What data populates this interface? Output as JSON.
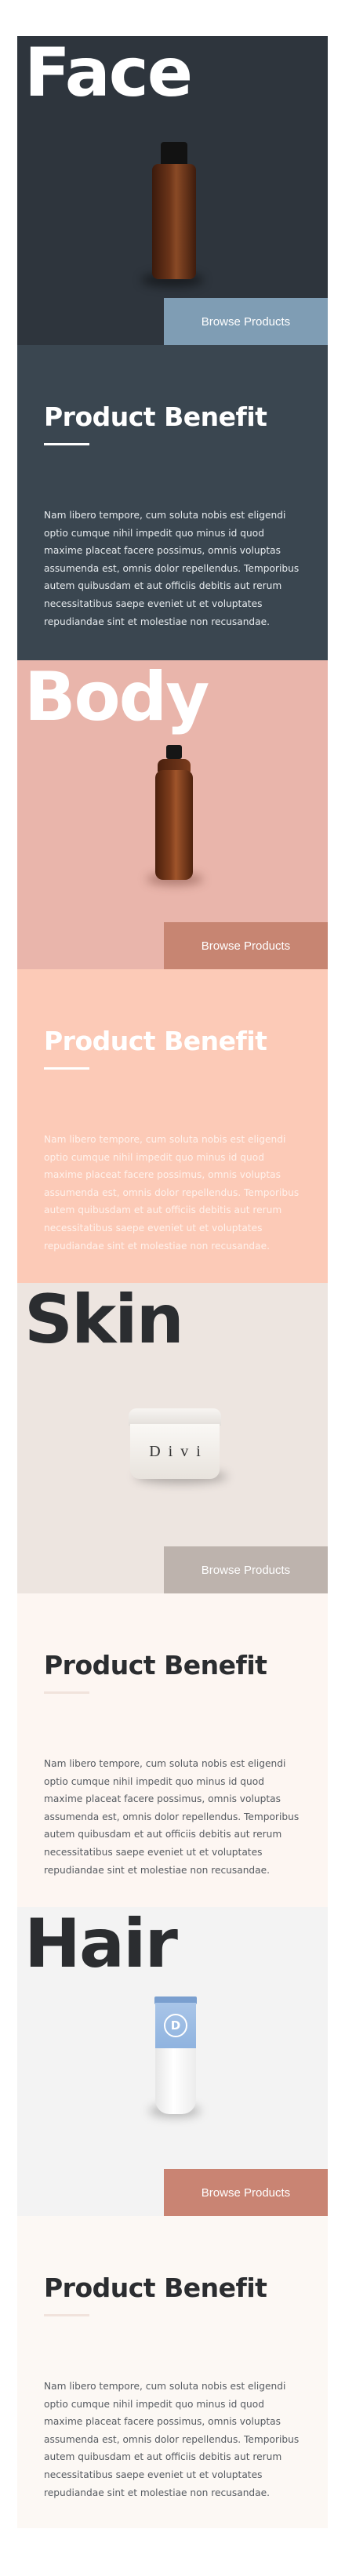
{
  "sections": [
    {
      "title": "Face",
      "browse_label": "Browse Products",
      "benefit_title": "Product Benefit",
      "benefit_text": "Nam libero tempore, cum soluta nobis est eligendi optio cumque nihil impedit quo minus id quod maxime placeat facere possimus, omnis voluptas assumenda est, omnis dolor repellendus. Temporibus autem quibusdam et aut officiis debitis aut rerum necessitatibus saepe eveniet ut et voluptates repudiandae sint et molestiae non recusandae."
    },
    {
      "title": "Body",
      "browse_label": "Browse Products",
      "benefit_title": "Product Benefit",
      "benefit_text": "Nam libero tempore, cum soluta nobis est eligendi optio cumque nihil impedit quo minus id quod maxime placeat facere possimus, omnis voluptas assumenda est, omnis dolor repellendus. Temporibus autem quibusdam et aut officiis debitis aut rerum necessitatibus saepe eveniet ut et voluptates repudiandae sint et molestiae non recusandae."
    },
    {
      "title": "Skin",
      "product_label": "Divi",
      "browse_label": "Browse Products",
      "benefit_title": "Product Benefit",
      "benefit_text": "Nam libero tempore, cum soluta nobis est eligendi optio cumque nihil impedit quo minus id quod maxime placeat facere possimus, omnis voluptas assumenda est, omnis dolor repellendus. Temporibus autem quibusdam et aut officiis debitis aut rerum necessitatibus saepe eveniet ut et voluptates repudiandae sint et molestiae non recusandae."
    },
    {
      "title": "Hair",
      "product_label": "D",
      "browse_label": "Browse Products",
      "benefit_title": "Product Benefit",
      "benefit_text": "Nam libero tempore, cum soluta nobis est eligendi optio cumque nihil impedit quo minus id quod maxime placeat facere possimus, omnis voluptas assumenda est, omnis dolor repellendus. Temporibus autem quibusdam et aut officiis debitis aut rerum necessitatibus saepe eveniet ut et voluptates repudiandae sint et molestiae non recusandae."
    }
  ],
  "colors": {
    "face_hero_bg": "#2e353d",
    "face_button_bg": "#7f9db4",
    "face_benefit_bg": "#3a4650",
    "body_hero_bg": "#e9b5ab",
    "body_button_bg": "#c78572",
    "body_benefit_bg": "#fccab7",
    "skin_hero_bg": "#ede5e0",
    "skin_button_bg": "#bdb3ad",
    "skin_benefit_bg": "#fdf6f2",
    "hair_hero_bg": "#f3f3f3",
    "hair_button_bg": "#c98473",
    "hair_benefit_bg": "#fcf8f4",
    "hair_tube": "#9dbce0"
  }
}
